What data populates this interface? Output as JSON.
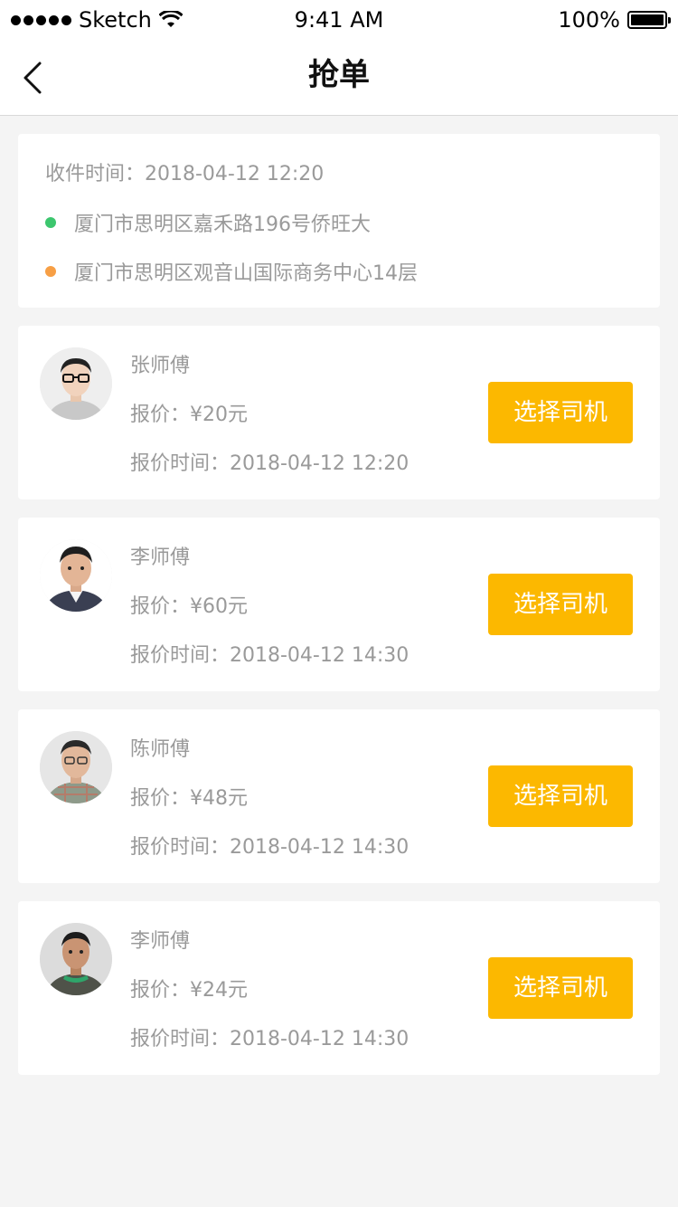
{
  "status_bar": {
    "carrier": "Sketch",
    "time": "9:41 AM",
    "battery": "100%"
  },
  "nav": {
    "title": "抢单"
  },
  "order": {
    "time_label": "收件时间：2018-04-12 12:20",
    "pickup_address": "厦门市思明区嘉禾路196号侨旺大",
    "pickup_dot_color": "#3cc66e",
    "dropoff_address": "厦门市思明区观音山国际商务中心14层",
    "dropoff_dot_color": "#f79f45"
  },
  "drivers": [
    {
      "name": "张师傅",
      "price": "报价：¥20元",
      "quote_time": "报价时间：2018-04-12 12:20",
      "button": "选择司机"
    },
    {
      "name": "李师傅",
      "price": "报价：¥60元",
      "quote_time": "报价时间：2018-04-12 14:30",
      "button": "选择司机"
    },
    {
      "name": "陈师傅",
      "price": "报价：¥48元",
      "quote_time": "报价时间：2018-04-12 14:30",
      "button": "选择司机"
    },
    {
      "name": "李师傅",
      "price": "报价：¥24元",
      "quote_time": "报价时间：2018-04-12 14:30",
      "button": "选择司机"
    }
  ],
  "colors": {
    "accent": "#fcb800",
    "background": "#f4f4f4",
    "secondary_text": "#9a9a9a"
  }
}
